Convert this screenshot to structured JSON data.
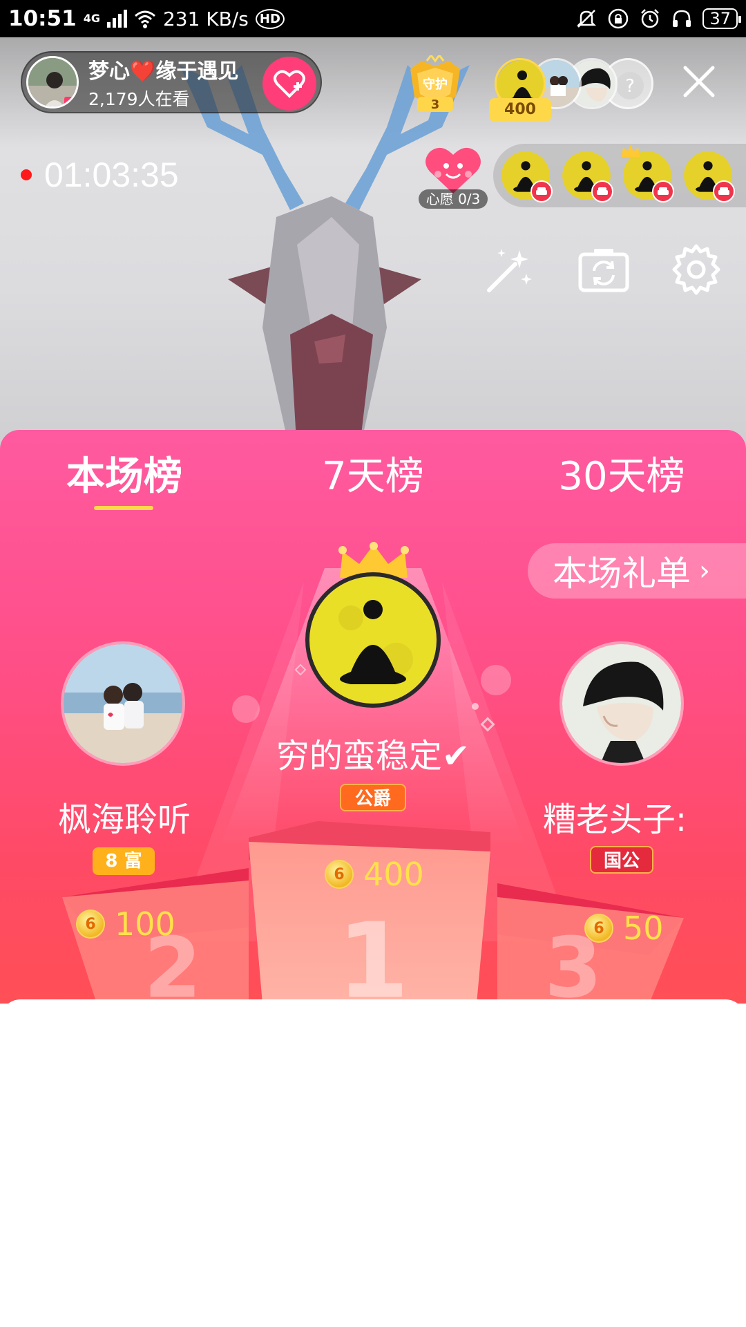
{
  "status_bar": {
    "time": "10:51",
    "network": "4G",
    "speed": "231 KB/s",
    "hd": "HD",
    "battery": "37"
  },
  "host": {
    "name": "梦心❤️缘于遇见",
    "viewers": "2,179人在看"
  },
  "guard": {
    "label": "守护",
    "count": "3"
  },
  "top_viewer_score": "400",
  "timer": "01:03:35",
  "wish": {
    "label": "心愿 0/3"
  },
  "tabs": [
    {
      "label": "本场榜"
    },
    {
      "label": "7天榜"
    },
    {
      "label": "30天榜"
    }
  ],
  "gift_list_button": "本场礼单",
  "ranking": {
    "first": {
      "name": "穷的蛮稳定✔",
      "badge": "公爵",
      "score": "400"
    },
    "second": {
      "name": "枫海聆听",
      "badge": "8 富",
      "score": "100"
    },
    "third": {
      "name": "糟老头子:",
      "badge": "国公",
      "score": "50"
    }
  },
  "colors": {
    "panel_top": "#ff5aa0",
    "panel_bottom": "#ff4f56",
    "accent_gold": "#ffd84a",
    "score_yellow": "#ffe14a",
    "follow_pink": "#ff3d78"
  }
}
